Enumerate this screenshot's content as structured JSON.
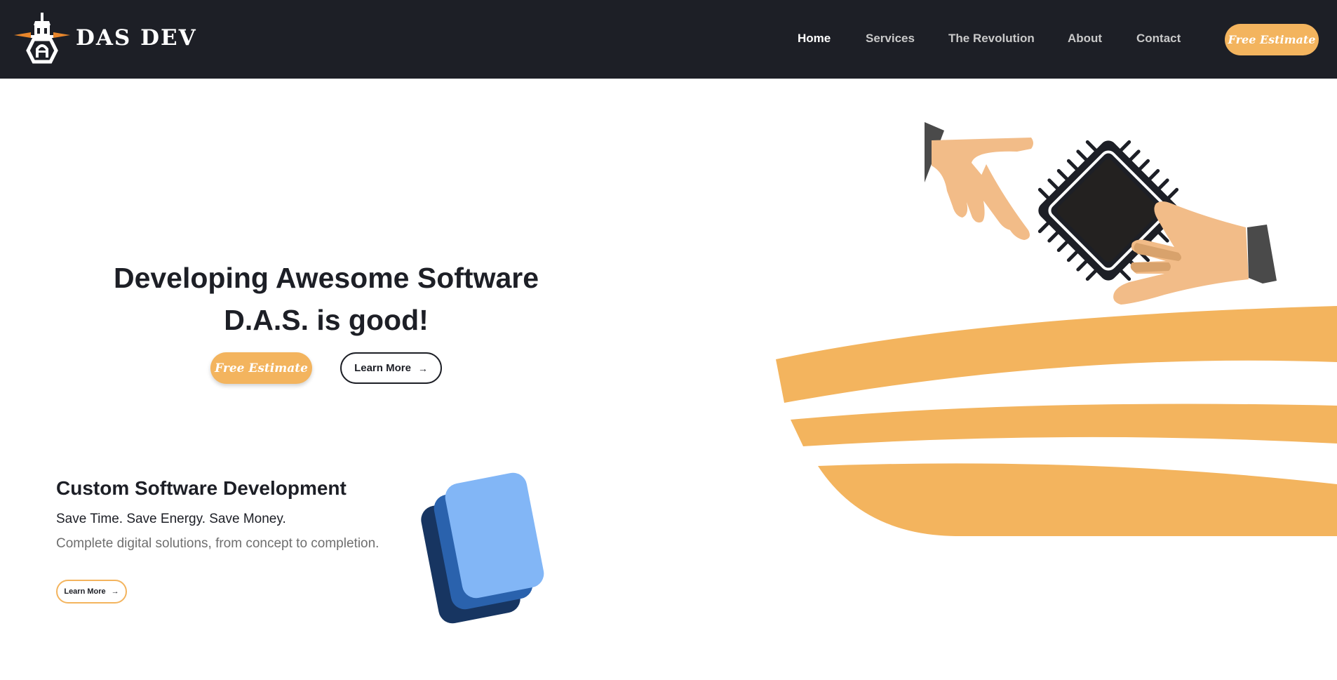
{
  "header": {
    "brand": "DAS DEV",
    "nav": [
      {
        "label": "Home",
        "active": true
      },
      {
        "label": "Services",
        "active": false
      },
      {
        "label": "The Revolution",
        "active": false
      },
      {
        "label": "About",
        "active": false
      },
      {
        "label": "Contact",
        "active": false
      }
    ],
    "cta_label": "Free Estimate"
  },
  "hero": {
    "title_line1": "Developing Awesome Software",
    "title_line2": "D.A.S. is good!",
    "estimate_label": "Free Estimate",
    "learn_more_label": "Learn More"
  },
  "section": {
    "title": "Custom Software Development",
    "subtitle": "Save Time. Save Energy. Save Money.",
    "description": "Complete digital solutions, from concept to completion.",
    "learn_more_label": "Learn More"
  },
  "icons": {
    "arrow": "→",
    "logo": "lighthouse-icon",
    "cards": "stacked-cards-icon",
    "illustration": "handshake-chip-illustration"
  },
  "colors": {
    "header_bg": "#1d1f26",
    "accent": "#f3b45e",
    "text_dark": "#1d1f26",
    "text_muted": "#6f6f6f",
    "skin": "#f2bc88",
    "card_light": "#82b6f6",
    "card_mid": "#2a62ad",
    "card_dark": "#173561"
  }
}
